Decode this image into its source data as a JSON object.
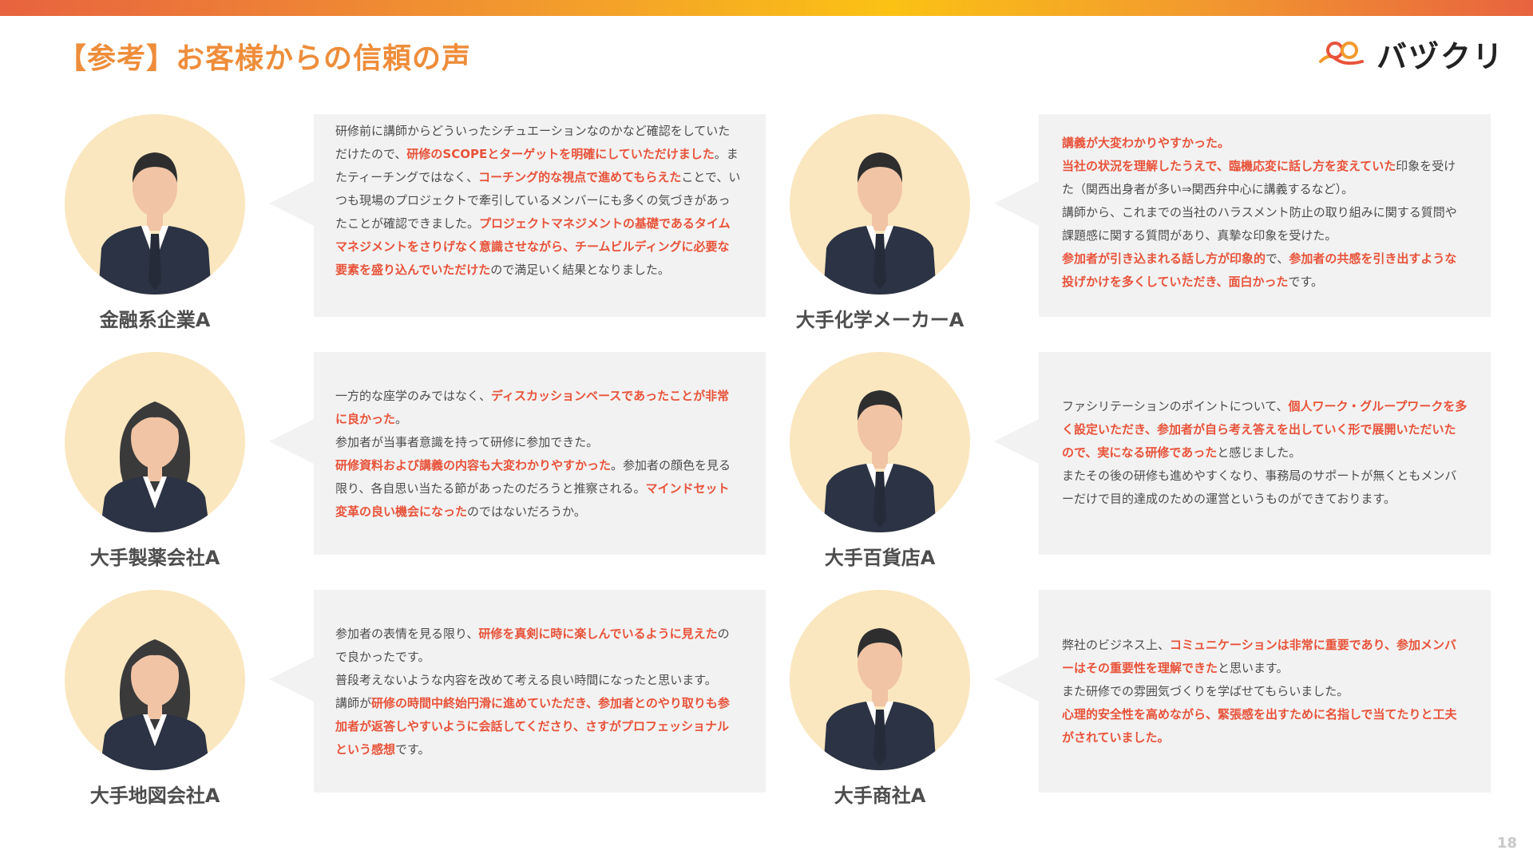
{
  "header": {
    "title": "【参考】お客様からの信頼の声",
    "logo_text": "バヅクリ",
    "page_number": "18"
  },
  "colors": {
    "accent_orange": "#ee8d3a",
    "highlight_red": "#e8533a",
    "bubble_bg": "#f2f2f2",
    "avatar_bg": "#fae7bf"
  },
  "testimonials": [
    {
      "company": "金融系企業A",
      "avatar": "man-in-suit-icon",
      "segments": [
        {
          "t": "研修前に講師からどういったシチュエーションなのかなど確認をしていただけたので、",
          "hl": false
        },
        {
          "t": "研修のSCOPEとターゲットを明確にしていただけました",
          "hl": true
        },
        {
          "t": "。またティーチングではなく、",
          "hl": false
        },
        {
          "t": "コーチング的な視点で進めてもらえた",
          "hl": true
        },
        {
          "t": "ことで、いつも現場のプロジェクトで牽引しているメンバーにも多くの気づきがあったことが確認できました。",
          "hl": false
        },
        {
          "t": "プロジェクトマネジメントの基礎であるタイムマネジメントをさりげなく意識させながら、チームビルディングに必要な要素を盛り込んでいただけた",
          "hl": true
        },
        {
          "t": "ので満足いく結果となりました。",
          "hl": false
        }
      ]
    },
    {
      "company": "大手化学メーカーA",
      "avatar": "man-in-suit-icon",
      "segments": [
        {
          "t": "講義が大変わかりやすかった。",
          "hl": true
        },
        {
          "br": true
        },
        {
          "t": "当社の状況を理解したうえで、臨機応変に話し方を変えていた",
          "hl": true
        },
        {
          "t": "印象を受けた（関西出身者が多い⇒関西弁中心に講義するなど）。",
          "hl": false
        },
        {
          "br": true
        },
        {
          "t": "講師から、これまでの当社のハラスメント防止の取り組みに関する質問や課題感に関する質問があり、真摯な印象を受けた。",
          "hl": false
        },
        {
          "br": true
        },
        {
          "t": "参加者が引き込まれる話し方が印象的",
          "hl": true
        },
        {
          "t": "で、",
          "hl": false
        },
        {
          "t": "参加者の共感を引き出すような投げかけを多くしていただき、面白かった",
          "hl": true
        },
        {
          "t": "です。",
          "hl": false
        }
      ]
    },
    {
      "company": "大手製薬会社A",
      "avatar": "woman-in-suit-icon",
      "segments": [
        {
          "t": "一方的な座学のみではなく、",
          "hl": false
        },
        {
          "t": "ディスカッションベースであったことが非常に良かった",
          "hl": true
        },
        {
          "t": "。",
          "hl": false
        },
        {
          "br": true
        },
        {
          "t": "参加者が当事者意識を持って研修に参加できた。",
          "hl": false
        },
        {
          "br": true
        },
        {
          "t": "研修資料および講義の内容も大変わかりやすかった",
          "hl": true
        },
        {
          "t": "。参加者の顔色を見る限り、各自思い当たる節があったのだろうと推察される。",
          "hl": false
        },
        {
          "t": "マインドセット変革の良い機会になった",
          "hl": true
        },
        {
          "t": "のではないだろうか。",
          "hl": false
        }
      ]
    },
    {
      "company": "大手百貨店A",
      "avatar": "man-in-suit-icon",
      "segments": [
        {
          "t": "ファシリテーションのポイントについて、",
          "hl": false
        },
        {
          "t": "個人ワーク・グループワークを多く設定いただき、参加者が自ら考え答えを出していく形で展開いただいたので、実になる研修であった",
          "hl": true
        },
        {
          "t": "と感じました。",
          "hl": false
        },
        {
          "br": true
        },
        {
          "t": "またその後の研修も進めやすくなり、事務局のサポートが無くともメンバーだけで目的達成のための運営というものができております。",
          "hl": false
        }
      ]
    },
    {
      "company": "大手地図会社A",
      "avatar": "woman-in-suit-icon",
      "segments": [
        {
          "t": "参加者の表情を見る限り、",
          "hl": false
        },
        {
          "t": "研修を真剣に時に楽しんでいるように見えた",
          "hl": true
        },
        {
          "t": "ので良かったです。",
          "hl": false
        },
        {
          "br": true
        },
        {
          "t": "普段考えないような内容を改めて考える良い時間になったと思います。",
          "hl": false
        },
        {
          "br": true
        },
        {
          "t": "講師が",
          "hl": false
        },
        {
          "t": "研修の時間中終始円滑に進めていただき、参加者とのやり取りも参加者が返答しやすいように会話してくださり、さすがプロフェッショナルという感想",
          "hl": true
        },
        {
          "t": "です。",
          "hl": false
        }
      ]
    },
    {
      "company": "大手商社A",
      "avatar": "man-in-suit-icon",
      "segments": [
        {
          "t": "弊社のビジネス上、",
          "hl": false
        },
        {
          "t": "コミュニケーションは非常に重要であり、参加メンバーはその重要性を理解できた",
          "hl": true
        },
        {
          "t": "と思います。",
          "hl": false
        },
        {
          "br": true
        },
        {
          "t": "また研修での雰囲気づくりを学ばせてもらいました。",
          "hl": false
        },
        {
          "br": true
        },
        {
          "t": "心理的安全性を高めながら、緊張感を出すために名指しで当てたりと工夫がされていました。",
          "hl": true
        }
      ]
    }
  ]
}
